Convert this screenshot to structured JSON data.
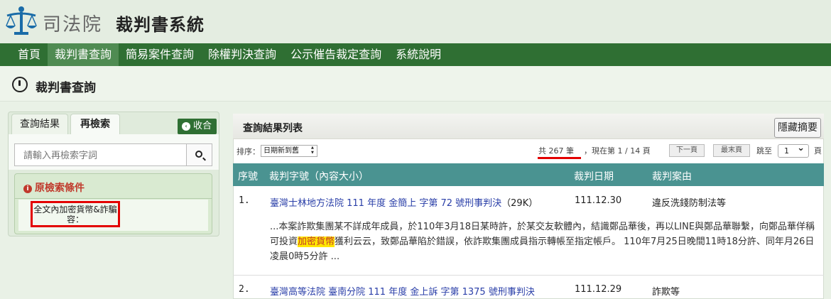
{
  "header": {
    "site_name": "司法院",
    "app_name": "裁判書系統"
  },
  "nav": {
    "items": [
      {
        "label": "首頁"
      },
      {
        "label": "裁判書查詢"
      },
      {
        "label": "簡易案件查詢"
      },
      {
        "label": "除權判決查詢"
      },
      {
        "label": "公示催告裁定查詢"
      },
      {
        "label": "系統說明"
      }
    ],
    "active_index": 1
  },
  "page": {
    "title": "裁判書查詢"
  },
  "left_panel": {
    "tabs": {
      "results": "查詢結果",
      "research": "再檢索"
    },
    "collapse_label": "收合",
    "search_placeholder": "請輸入再檢索字詞",
    "criteria_title": "原檢索條件",
    "criteria_value_line1": "全文內加密貨幣&詐騙",
    "criteria_value_line2": "容："
  },
  "results": {
    "title": "查詢結果列表",
    "hide_summary_label": "隱藏摘要",
    "sort_label": "排序：",
    "sort_value": "日期新到舊",
    "total_text": "共 267 筆",
    "position_text": "，現在第 1 / 14 頁",
    "next_page_label": "下一頁",
    "last_page_label": "最末頁",
    "jump_label": "跳至",
    "jump_value": "1",
    "page_unit": "頁",
    "columns": {
      "no": "序號",
      "case": "裁判字號（內容大小）",
      "date": "裁判日期",
      "reason": "裁判案由"
    },
    "rows": [
      {
        "no": "1.",
        "case": "臺灣士林地方法院 111 年度 金簡上 字第 72 號刑事判決",
        "size": "（29K）",
        "date": "111.12.30",
        "reason": "違反洗錢防制法等",
        "summary_before": "...本案詐欺集團某不詳成年成員，於110年3月18日某時許，於某交友軟體內，結識鄭品華後，再以LINE與鄭品華聯繫，向鄭品華佯稱可投資",
        "summary_highlight": "加密貨幣",
        "summary_after": "獲利云云，致鄭品華陷於錯誤，依詐欺集團成員指示轉帳至指定帳戶。 110年7月25日晚間11時18分許、同年月26日凌晨0時5分許 ..."
      },
      {
        "no": "2.",
        "case": "臺灣高等法院 臺南分院 111 年度 金上訴 字第 1375 號刑事判決",
        "size": "",
        "date": "111.12.29",
        "reason": "詐欺等"
      }
    ]
  },
  "colors": {
    "nav_bg": "#2f6f33",
    "table_header_bg": "#4a9391",
    "link": "#2a3fa8",
    "highlight_bg": "#ffe600",
    "annotation_red": "#e30000"
  }
}
